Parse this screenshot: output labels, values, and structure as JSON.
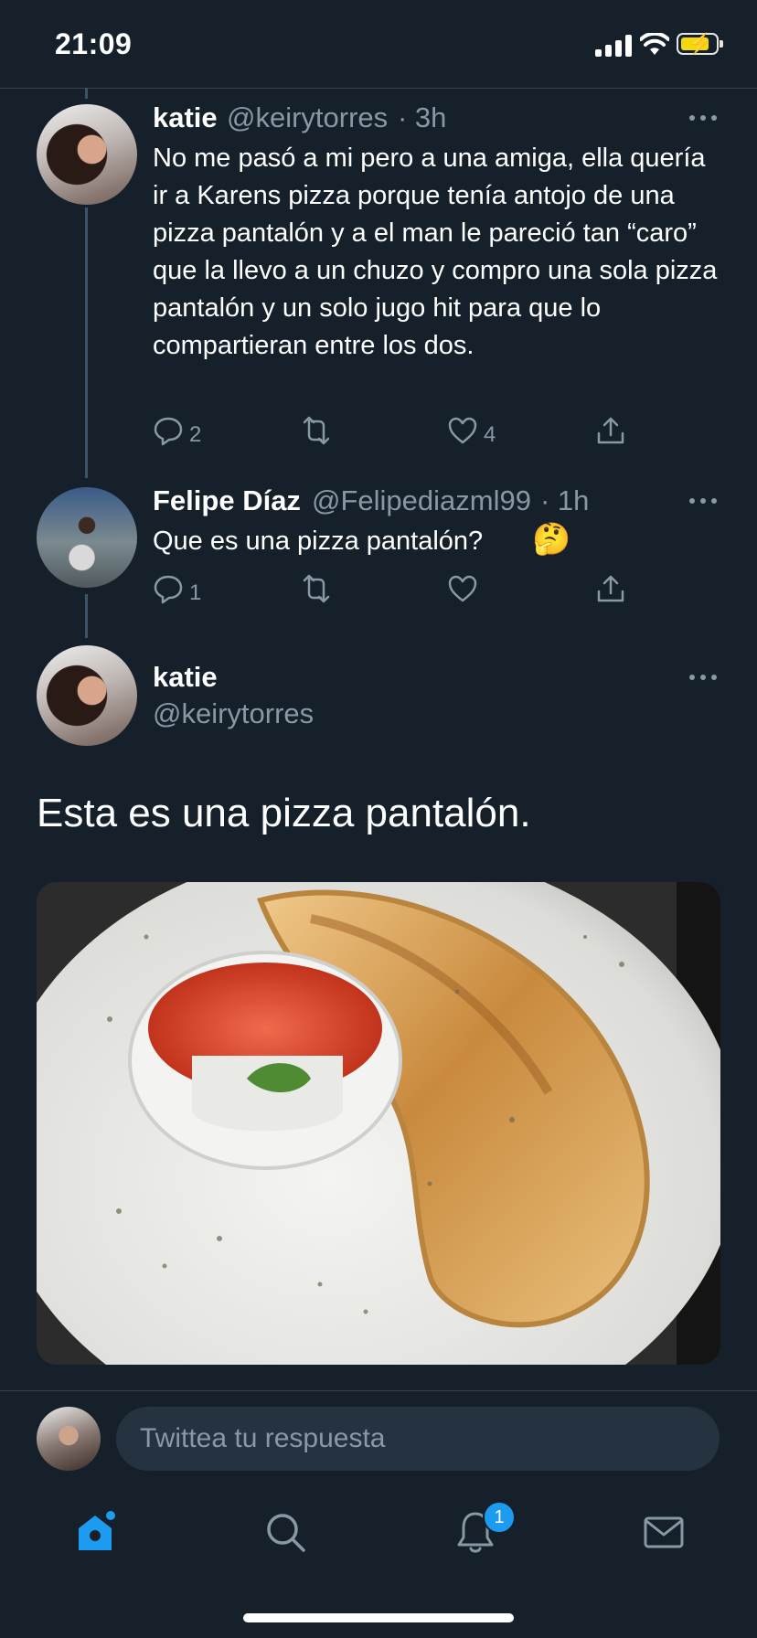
{
  "status_bar": {
    "time": "21:09"
  },
  "tweets": [
    {
      "name": "katie",
      "handle": "@keirytorres",
      "time": "· 3h",
      "text": "No me pasó a mi pero a una amiga, ella quería ir a Karens pizza porque tenía antojo de una pizza pantalón y a el man le pareció tan “caro” que la llevo a un chuzo y compro una sola pizza pantalón y un solo jugo hit para que lo compartieran entre los dos.",
      "replies": "2",
      "retweets": "",
      "likes": "4"
    },
    {
      "name": "Felipe Díaz",
      "handle": "@Felipediazml99",
      "time": "· 1h",
      "text": "Que es una pizza pantalón?",
      "emoji": "🤔",
      "replies": "1",
      "retweets": "",
      "likes": ""
    }
  ],
  "main_tweet": {
    "name": "katie",
    "handle": "@keirytorres",
    "text": "Esta es una pizza pantalón.",
    "media_icon": "calzone-photo"
  },
  "reply": {
    "placeholder": "Twittea tu respuesta"
  },
  "tabbar": {
    "notification_badge": "1",
    "accent_color": "#1d9bf0",
    "icons": [
      "home-icon",
      "search-icon",
      "notifications-icon",
      "messages-icon"
    ]
  },
  "colors": {
    "background": "#15202b",
    "secondary_text": "#8899a6",
    "divider": "#38444d"
  }
}
